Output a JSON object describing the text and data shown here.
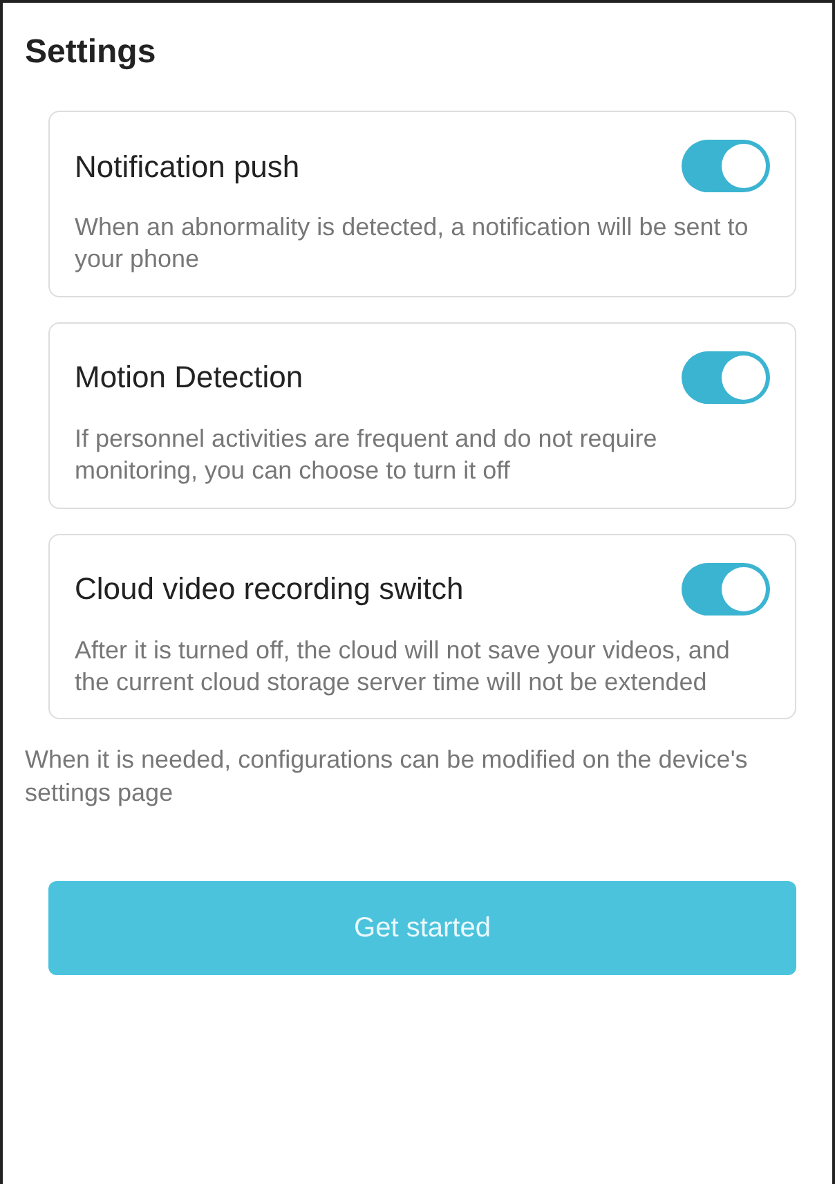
{
  "title": "Settings",
  "settings": [
    {
      "label": "Notification push",
      "on": true,
      "description": "When an abnormality is detected, a notification will be sent to your phone"
    },
    {
      "label": "Motion Detection",
      "on": true,
      "description": "If personnel activities are frequent and do not require monitoring, you can choose to turn it off"
    },
    {
      "label": "Cloud video recording switch",
      "on": true,
      "description": "After it is turned off, the cloud will not save your videos, and the current cloud storage server time will not be extended"
    }
  ],
  "note": "When it is needed, configurations can be modified on the device's settings page",
  "button": "Get started"
}
